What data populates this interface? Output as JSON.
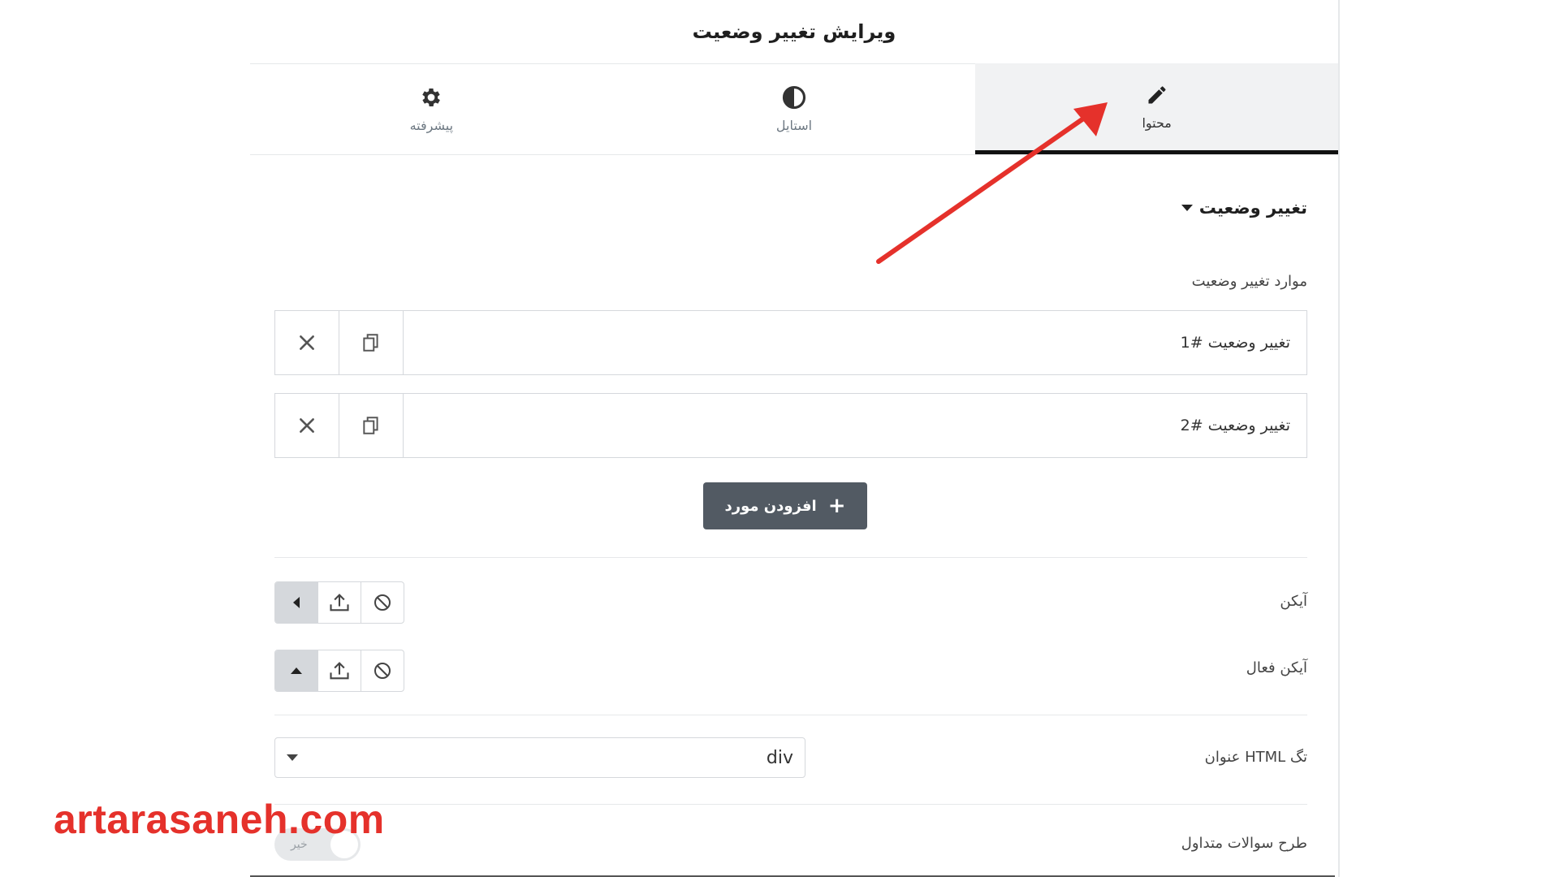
{
  "panel": {
    "title": "ویرایش تغییر وضعیت"
  },
  "tabs": [
    {
      "label": "محتوا",
      "icon": "pencil-icon",
      "active": true
    },
    {
      "label": "استایل",
      "icon": "contrast-icon",
      "active": false
    },
    {
      "label": "پیشرفته",
      "icon": "gear-icon",
      "active": false
    }
  ],
  "section": {
    "title": "تغییر وضعیت"
  },
  "repeater": {
    "label": "موارد تغییر وضعیت",
    "items": [
      {
        "title": "تغییر وضعیت #1"
      },
      {
        "title": "تغییر وضعیت #2"
      }
    ],
    "add_label": "افزودن مورد"
  },
  "icon_field": {
    "label": "آیکن"
  },
  "active_icon_field": {
    "label": "آیکن فعال"
  },
  "title_tag": {
    "label": "تگ HTML عنوان",
    "value": "div"
  },
  "faq_schema": {
    "label": "طرح سوالات متداول",
    "toggle_text": "خیر"
  },
  "watermark": {
    "text": "artarasaneh.com"
  },
  "colors": {
    "accent_dark": "#525a63",
    "annotation_arrow": "#e5312b",
    "watermark": "#e5312b"
  }
}
